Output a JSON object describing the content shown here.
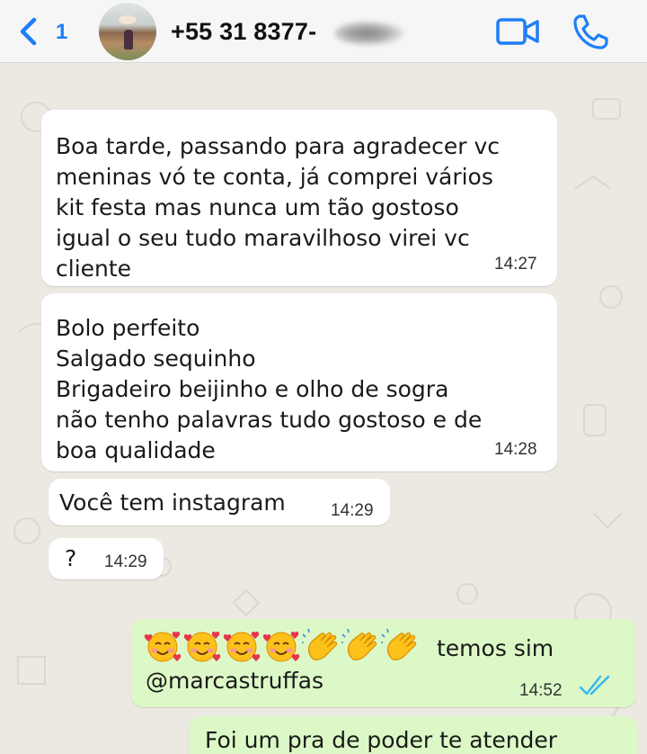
{
  "header": {
    "back_count": "1",
    "contact_name": "+55 31 8377-",
    "icons": [
      "chevron-left-icon",
      "video-camera-icon",
      "phone-icon"
    ],
    "accent_color": "#1e7ef6"
  },
  "messages": [
    {
      "direction": "incoming",
      "lines": [
        "Boa tarde, passando para agradecer vc",
        "meninas vó te conta, já comprei vários",
        "kit festa mas nunca um tão gostoso",
        "igual  o seu tudo maravilhoso virei vc",
        "cliente"
      ],
      "time": "14:27"
    },
    {
      "direction": "incoming",
      "lines": [
        "Bolo perfeito",
        "Salgado sequinho",
        "Brigadeiro beijinho e olho de sogra",
        "não tenho palavras tudo gostoso e de",
        "boa qualidade"
      ],
      "time": "14:28"
    },
    {
      "direction": "incoming",
      "lines": [
        "Você tem instagram"
      ],
      "time": "14:29"
    },
    {
      "direction": "incoming",
      "lines": [
        "?"
      ],
      "time": "14:29"
    },
    {
      "direction": "outgoing",
      "emojis": [
        "smiling-face-with-hearts",
        "smiling-face-with-hearts",
        "smiling-face-with-hearts",
        "smiling-face-with-hearts",
        "clapping-hands",
        "clapping-hands",
        "clapping-hands"
      ],
      "lines": [
        "temos sim",
        "@marcastruffas"
      ],
      "time": "14:52",
      "status": "read"
    },
    {
      "direction": "outgoing",
      "lines": [
        "Foi um pra de poder te atender"
      ]
    }
  ],
  "colors": {
    "incoming_bubble": "#ffffff",
    "outgoing_bubble": "#dcf8c6",
    "chat_background": "#ece8e2",
    "read_ticks": "#34b7f1"
  }
}
